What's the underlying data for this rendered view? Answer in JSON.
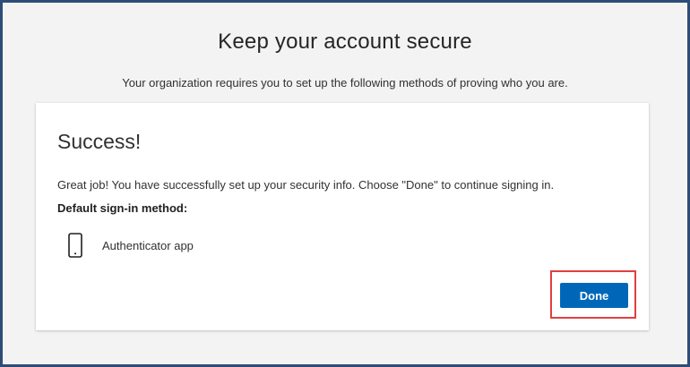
{
  "page": {
    "title": "Keep your account secure",
    "subtitle": "Your organization requires you to set up the following methods of proving who you are."
  },
  "card": {
    "heading": "Success!",
    "message": "Great job! You have successfully set up your security info. Choose \"Done\" to continue signing in.",
    "default_method_label": "Default sign-in method:",
    "method": {
      "icon": "mobile-phone-icon",
      "name": "Authenticator app"
    },
    "done_label": "Done"
  },
  "colors": {
    "frame_border": "#2e4c78",
    "page_background": "#f3f3f3",
    "primary_button": "#0067b8",
    "highlight_box": "#e0403f"
  }
}
